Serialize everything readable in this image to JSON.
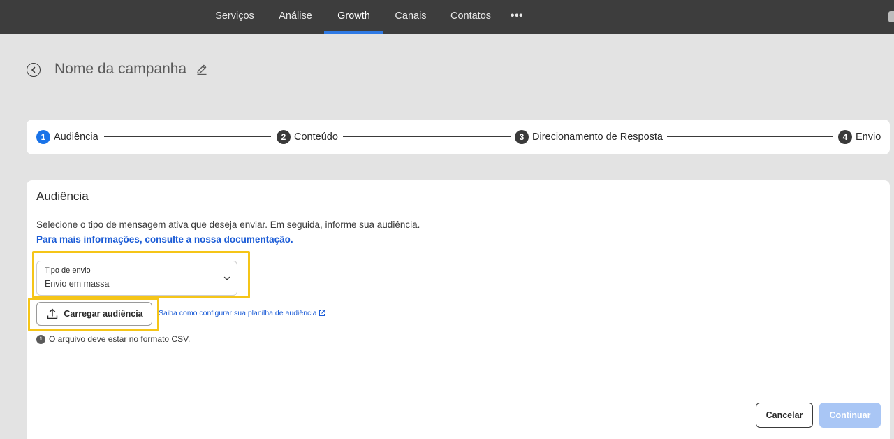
{
  "nav": {
    "items": [
      {
        "label": "Serviços"
      },
      {
        "label": "Análise"
      },
      {
        "label": "Growth",
        "active": true
      },
      {
        "label": "Canais"
      },
      {
        "label": "Contatos"
      }
    ],
    "more_label": "•••"
  },
  "header": {
    "campaign_name": "Nome da campanha"
  },
  "stepper": {
    "steps": [
      {
        "number": "1",
        "label": "Audiência",
        "active": true
      },
      {
        "number": "2",
        "label": "Conteúdo"
      },
      {
        "number": "3",
        "label": "Direcionamento de Resposta"
      },
      {
        "number": "4",
        "label": "Envio"
      }
    ]
  },
  "audience": {
    "title": "Audiência",
    "description": "Selecione o tipo de mensagem ativa que deseja enviar. Em seguida, informe sua audiência.",
    "doc_link": "Para mais informações, consulte a nossa documentação.",
    "send_type": {
      "label": "Tipo de envio",
      "value": "Envio em massa"
    },
    "upload_button": "Carregar audiência",
    "help_link": "Saiba como configurar sua planilha de audiência",
    "info_text": "O arquivo deve estar no formato CSV."
  },
  "footer": {
    "cancel": "Cancelar",
    "continue": "Continuar"
  },
  "colors": {
    "accent": "#1a73e8",
    "link": "#1a5bd6",
    "highlight": "#f5c518",
    "disabled_button": "#a9c6f5"
  }
}
